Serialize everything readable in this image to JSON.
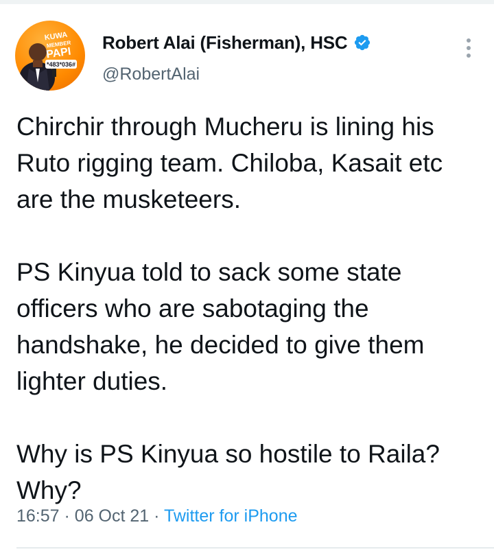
{
  "author": {
    "display_name": "Robert Alai (Fisherman), HSC",
    "handle": "@RobertAlai",
    "verified": true,
    "avatar": {
      "line1": "KUWA",
      "line2": "MEMBER",
      "line3": "PAPI",
      "code": "*483*036#",
      "background": "#ff8a00"
    }
  },
  "tweet": {
    "paragraphs": [
      "Chirchir through Mucheru is lining his Ruto rigging team. Chiloba, Kasait etc are the musketeers.",
      "PS Kinyua told to sack some state officers who are sabotaging the handshake, he decided to give them lighter duties.",
      "Why is PS Kinyua so hostile to Raila? Why?"
    ],
    "time": "16:57",
    "separator": "·",
    "date": "06 Oct 21",
    "source": "Twitter for iPhone"
  },
  "icons": {
    "verified": "verified-badge-icon",
    "more": "more-options-icon"
  },
  "colors": {
    "link": "#1d9bf0",
    "secondary_text": "#536471",
    "verified": "#1d9bf0",
    "avatar_accent": "#ff8a00"
  }
}
